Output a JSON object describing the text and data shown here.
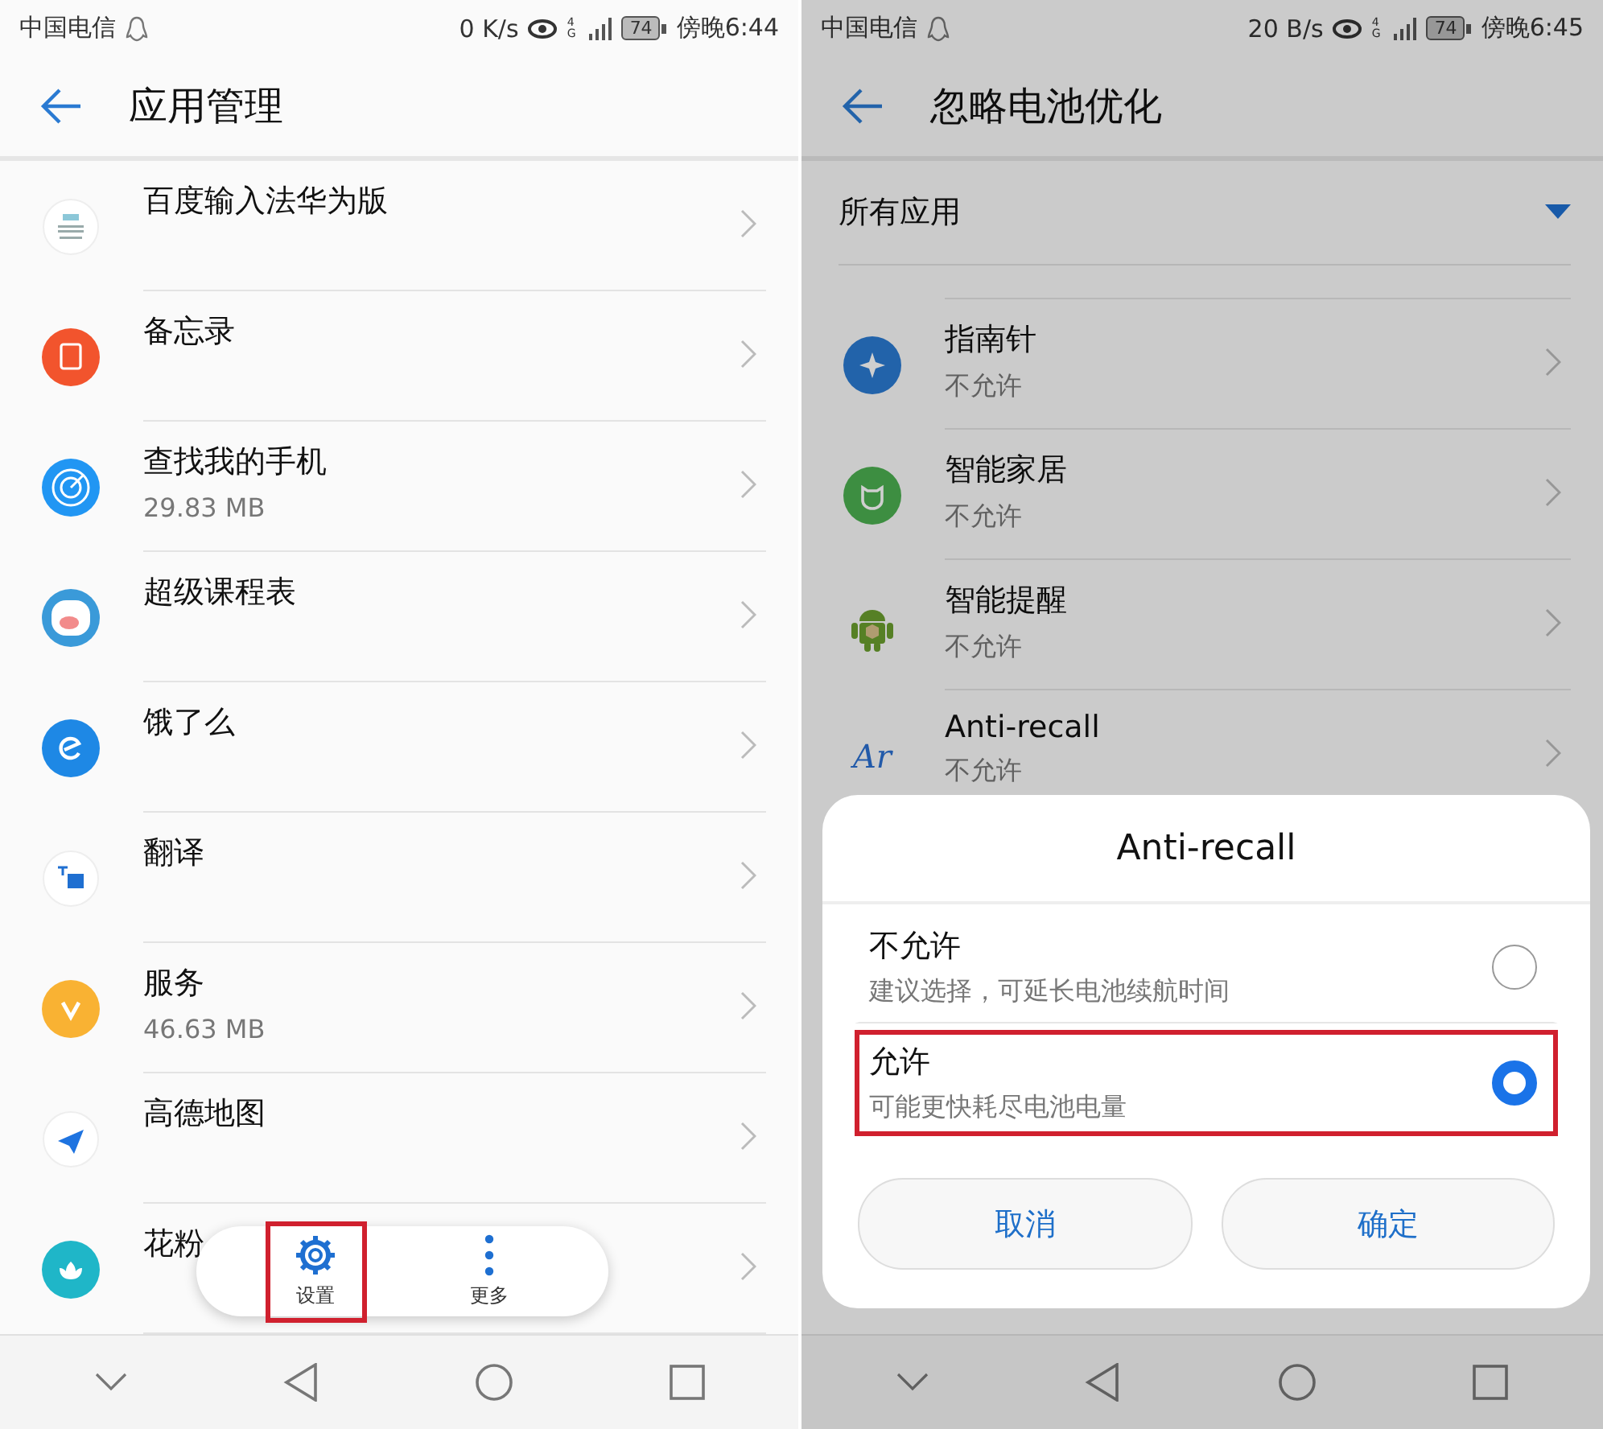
{
  "left_screen": {
    "status_bar": {
      "carrier": "中国电信",
      "speed": "0 K/s",
      "network": "4G",
      "battery": "74",
      "time": "傍晚6:44"
    },
    "header": {
      "title": "应用管理"
    },
    "apps": [
      {
        "name": "百度输入法华为版",
        "kind": "keyboard"
      },
      {
        "name": "备忘录",
        "kind": "notes"
      },
      {
        "name": "查找我的手机",
        "size": "29.83 MB",
        "kind": "radar"
      },
      {
        "name": "超级课程表",
        "kind": "mascot"
      },
      {
        "name": "饿了么",
        "kind": "eleme"
      },
      {
        "name": "翻译",
        "kind": "translate"
      },
      {
        "name": "服务",
        "size": "46.63 MB",
        "kind": "service"
      },
      {
        "name": "高德地图",
        "kind": "map"
      },
      {
        "name": "花粉",
        "kind": "flower"
      }
    ],
    "bottom_actions": [
      {
        "label": "设置",
        "kind": "settings",
        "highlighted": true
      },
      {
        "label": "更多",
        "kind": "more",
        "highlighted": false
      }
    ]
  },
  "right_screen": {
    "status_bar": {
      "carrier": "中国电信",
      "speed": "20 B/s",
      "network": "4G",
      "battery": "74",
      "time": "傍晚6:45"
    },
    "header": {
      "title": "忽略电池优化"
    },
    "filter": {
      "label": "所有应用"
    },
    "apps": [
      {
        "name": "指南针",
        "status": "不允许",
        "kind": "compass"
      },
      {
        "name": "智能家居",
        "status": "不允许",
        "kind": "home"
      },
      {
        "name": "智能提醒",
        "status": "不允许",
        "kind": "android"
      },
      {
        "name": "Anti-recall",
        "status": "不允许",
        "kind": "ar",
        "icon_text": "Ar"
      }
    ],
    "dialog": {
      "title": "Anti-recall",
      "options": [
        {
          "label": "不允许",
          "hint": "建议选择，可延长电池续航时间",
          "selected": false,
          "highlighted": false
        },
        {
          "label": "允许",
          "hint": "可能更快耗尽电池电量",
          "selected": true,
          "highlighted": true
        }
      ],
      "buttons": [
        "取消",
        "确定"
      ]
    }
  }
}
